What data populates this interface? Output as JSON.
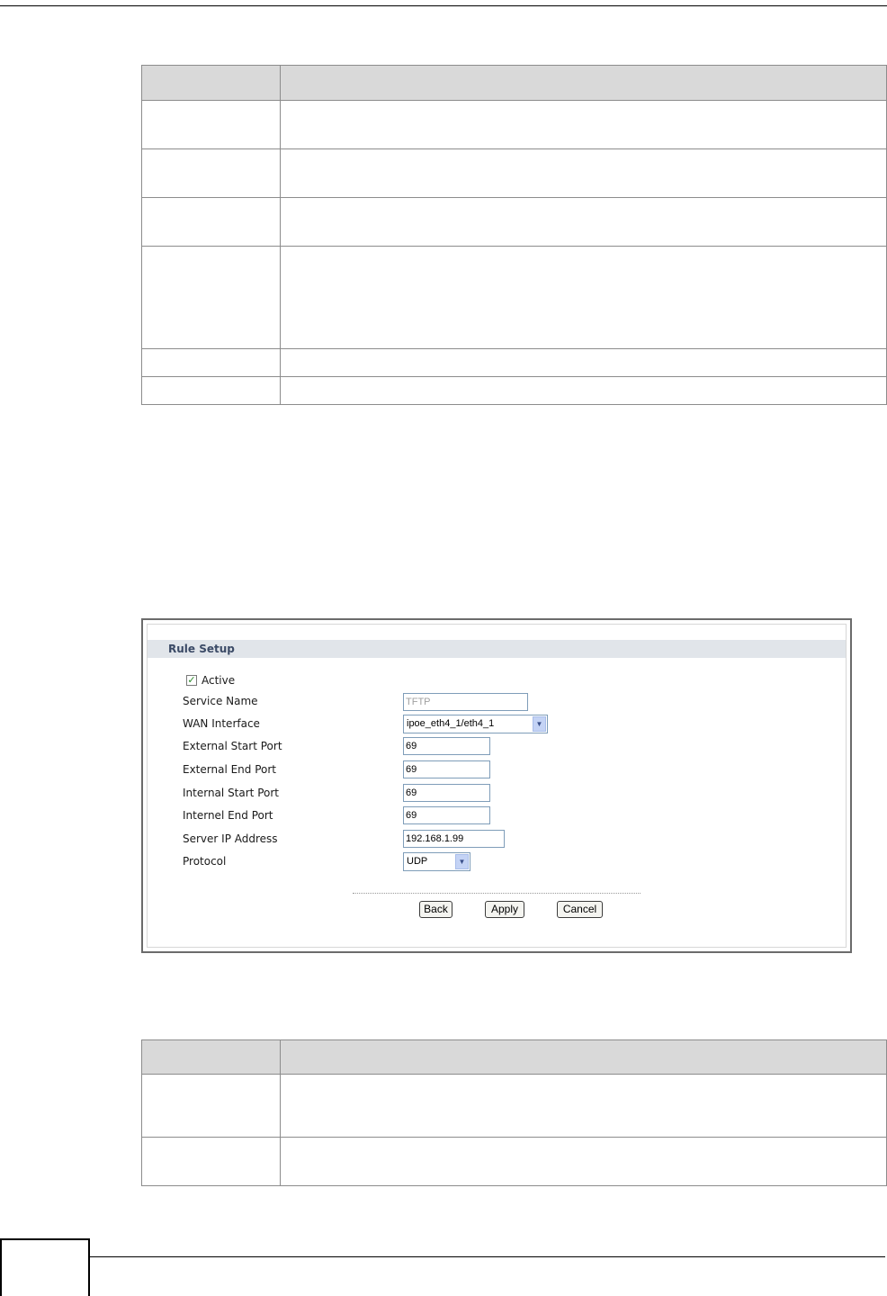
{
  "rule_setup": {
    "title": "Rule Setup",
    "active_label": "Active",
    "active_checked_glyph": "✓",
    "fields": {
      "service_name_label": "Service Name",
      "service_name_value": "TFTP",
      "wan_interface_label": "WAN Interface",
      "wan_interface_value": "ipoe_eth4_1/eth4_1",
      "external_start_port_label": "External Start Port",
      "external_start_port_value": "69",
      "external_end_port_label": "External End Port",
      "external_end_port_value": "69",
      "internal_start_port_label": "Internal Start Port",
      "internal_start_port_value": "69",
      "internel_end_port_label": "Internel End Port",
      "internel_end_port_value": "69",
      "server_ip_label": "Server IP Address",
      "server_ip_value": "192.168.1.99",
      "protocol_label": "Protocol",
      "protocol_value": "UDP"
    },
    "buttons": {
      "back": "Back",
      "apply": "Apply",
      "cancel": "Cancel"
    },
    "dropdown_arrow_glyph": "▼"
  },
  "colors": {
    "section_bar": "#e1e5ea",
    "section_title": "#3b4a66",
    "table_header": "#d9d9d9",
    "dropdown_button": "#c4d3f5"
  }
}
